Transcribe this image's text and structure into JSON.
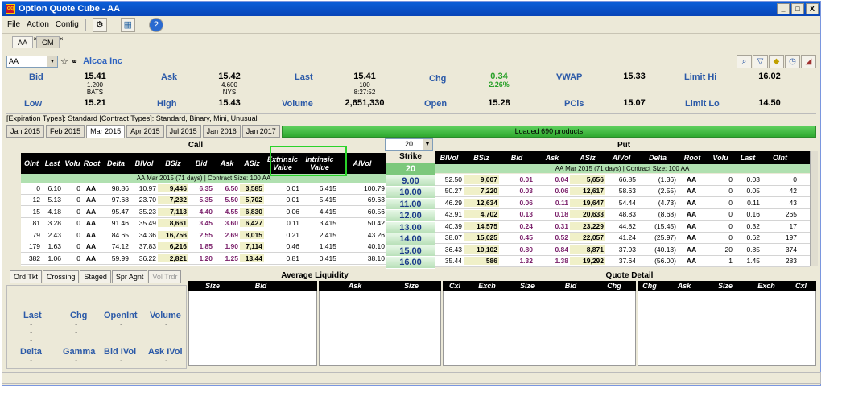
{
  "window": {
    "title": "Option Quote Cube - AA",
    "controls": [
      "_",
      "□",
      "X"
    ]
  },
  "menu": {
    "items": [
      "File",
      "Action",
      "Config"
    ]
  },
  "doc_tabs": [
    {
      "label": "AA",
      "active": true
    },
    {
      "label": "GM",
      "active": false
    }
  ],
  "symbol": {
    "value": "AA",
    "company": "Alcoa Inc"
  },
  "quote": {
    "bid_label": "Bid",
    "bid": "15.41",
    "bid_size": "1.200",
    "bid_exch": "BATS",
    "ask_label": "Ask",
    "ask": "15.42",
    "ask_size": "4.600",
    "ask_exch": "NYS",
    "last_label": "Last",
    "last": "15.41",
    "last_size": "100",
    "last_time": "8:27:52",
    "chg_label": "Chg",
    "chg": "0.34",
    "chg_pct": "2.26%",
    "vwap_label": "VWAP",
    "vwap": "15.33",
    "limit_hi_label": "Limit Hi",
    "limit_hi": "16.02",
    "low_label": "Low",
    "low": "15.21",
    "high_label": "High",
    "high": "15.43",
    "volume_label": "Volume",
    "volume": "2,651,330",
    "open_label": "Open",
    "open": "15.28",
    "pcls_label": "PCls",
    "pcls": "15.07",
    "limit_lo_label": "Limit Lo",
    "limit_lo": "14.50"
  },
  "info_line": "[Expiration Types]: Standard    [Contract Types]: Standard, Binary, Mini, Unusual",
  "expirations": [
    "Jan 2015",
    "Feb 2015",
    "Mar 2015",
    "Apr 2015",
    "Jul 2015",
    "Jan 2016",
    "Jan 2017"
  ],
  "active_expiration": "Mar 2015",
  "status": "Loaded 690 products",
  "strike_count": "20",
  "call_title": "Call",
  "put_title": "Put",
  "call_columns": [
    "OInt",
    "Last",
    "Volu",
    "Root",
    "Delta",
    "BIVol",
    "BSiz",
    "Bid",
    "Ask",
    "ASiz",
    "Extrinsic Value",
    "Intrinsic Value",
    "AIVol"
  ],
  "put_columns": [
    "BIVol",
    "BSiz",
    "Bid",
    "Ask",
    "ASiz",
    "AIVol",
    "Delta",
    "Root",
    "Volu",
    "Last",
    "OInt"
  ],
  "strike_header": "Strike",
  "group_label": "AA Mar 2015 (71 days) | Contract Size: 100 AA",
  "strikes": [
    "20",
    "9.00",
    "10.00",
    "11.00",
    "12.00",
    "13.00",
    "14.00",
    "15.00",
    "16.00"
  ],
  "call_rows": [
    [
      "0",
      "6.10",
      "0",
      "AA",
      "98.86",
      "10.97",
      "9,446",
      "6.35",
      "6.50",
      "3,585",
      "0.01",
      "6.415",
      "100.79"
    ],
    [
      "12",
      "5.13",
      "0",
      "AA",
      "97.68",
      "23.70",
      "7,232",
      "5.35",
      "5.50",
      "5,702",
      "0.01",
      "5.415",
      "69.63"
    ],
    [
      "15",
      "4.18",
      "0",
      "AA",
      "95.47",
      "35.23",
      "7,113",
      "4.40",
      "4.55",
      "6,830",
      "0.06",
      "4.415",
      "60.56"
    ],
    [
      "81",
      "3.28",
      "0",
      "AA",
      "91.46",
      "35.49",
      "8,661",
      "3.45",
      "3.60",
      "6,427",
      "0.11",
      "3.415",
      "50.42"
    ],
    [
      "79",
      "2.43",
      "0",
      "AA",
      "84.65",
      "34.36",
      "16,756",
      "2.55",
      "2.69",
      "8,015",
      "0.21",
      "2.415",
      "43.26"
    ],
    [
      "179",
      "1.63",
      "0",
      "AA",
      "74.12",
      "37.83",
      "6,216",
      "1.85",
      "1.90",
      "7,114",
      "0.46",
      "1.415",
      "40.10"
    ],
    [
      "382",
      "1.06",
      "0",
      "AA",
      "59.99",
      "36.22",
      "2,821",
      "1.20",
      "1.25",
      "13,44",
      "0.81",
      "0.415",
      "38.10"
    ]
  ],
  "put_rows": [
    [
      "52.50",
      "9,007",
      "0.01",
      "0.04",
      "5,656",
      "66.85",
      "(1.36)",
      "AA",
      "0",
      "0.03",
      "0"
    ],
    [
      "50.27",
      "7,220",
      "0.03",
      "0.06",
      "12,617",
      "58.63",
      "(2.55)",
      "AA",
      "0",
      "0.05",
      "42"
    ],
    [
      "46.29",
      "12,634",
      "0.06",
      "0.11",
      "19,647",
      "54.44",
      "(4.73)",
      "AA",
      "0",
      "0.11",
      "43"
    ],
    [
      "43.91",
      "4,702",
      "0.13",
      "0.18",
      "20,633",
      "48.83",
      "(8.68)",
      "AA",
      "0",
      "0.16",
      "265"
    ],
    [
      "40.39",
      "14,575",
      "0.24",
      "0.31",
      "23,229",
      "44.82",
      "(15.45)",
      "AA",
      "0",
      "0.32",
      "17"
    ],
    [
      "38.07",
      "15,025",
      "0.45",
      "0.52",
      "22,057",
      "41.24",
      "(25.97)",
      "AA",
      "0",
      "0.62",
      "197"
    ],
    [
      "36.43",
      "10,102",
      "0.80",
      "0.84",
      "8,871",
      "37.93",
      "(40.13)",
      "AA",
      "20",
      "0.85",
      "374"
    ],
    [
      "35.44",
      "586",
      "1.32",
      "1.38",
      "19,292",
      "37.64",
      "(56.00)",
      "AA",
      "1",
      "1.45",
      "283"
    ]
  ],
  "bottom_tabs": [
    "Ord Tkt",
    "Crossing",
    "Staged",
    "Spr Agnt",
    "Vol Trdr"
  ],
  "stats": {
    "labels": [
      "Last",
      "Chg",
      "OpenInt",
      "Volume",
      "Delta",
      "Gamma",
      "Bid IVol",
      "Ask IVol"
    ],
    "dash": "-"
  },
  "avg_liquidity": {
    "title": "Average Liquidity",
    "columns": [
      "Size",
      "Bid",
      "Ask",
      "Size"
    ]
  },
  "quote_detail": {
    "title": "Quote Detail",
    "columns": [
      "Cxl",
      "Exch",
      "Size",
      "Bid",
      "Chg",
      "Chg",
      "Ask",
      "Size",
      "Exch",
      "Cxl"
    ]
  }
}
